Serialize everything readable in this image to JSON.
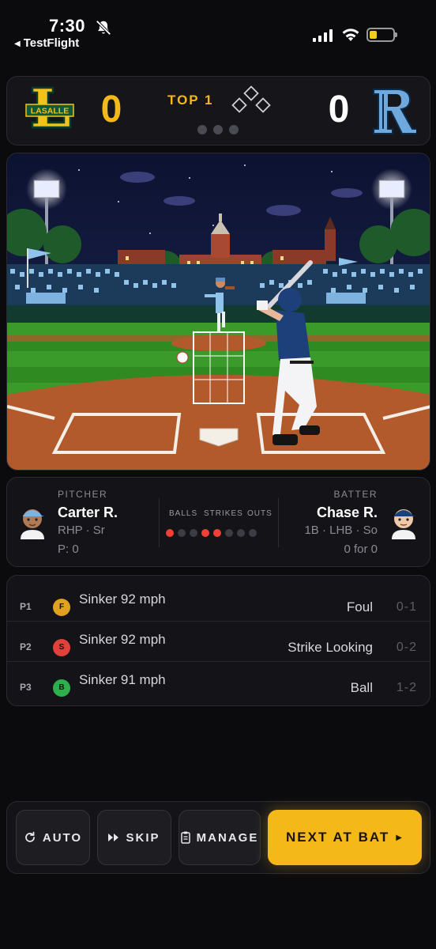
{
  "status_bar": {
    "time": "7:30",
    "back_app": "TestFlight",
    "battery_color": "#f3cb19"
  },
  "scoreboard": {
    "away_team_logo": "L",
    "away_team_logo_text": "LASALLE",
    "away_score": "0",
    "inning": "TOP 1",
    "home_team_logo": "R",
    "home_score": "0",
    "accent_color": "#f5b819"
  },
  "matchup": {
    "pitcher": {
      "role": "PITCHER",
      "name": "Carter R.",
      "info": "RHP · Sr",
      "pitch_count": "P: 0"
    },
    "batter": {
      "role": "BATTER",
      "name": "Chase R.",
      "info": "1B · LHB · So",
      "line": "0 for 0"
    },
    "count": {
      "balls_label": "BALLS",
      "strikes_label": "STRIKES",
      "outs_label": "OUTS",
      "balls": 1,
      "strikes": 2,
      "outs": 0
    }
  },
  "pitch_log": [
    {
      "num": "P1",
      "badge": "F",
      "badge_color": "#e0a21f",
      "pitch": "Sinker 92 mph",
      "result": "Foul",
      "count": "0-1"
    },
    {
      "num": "P2",
      "badge": "S",
      "badge_color": "#e0413a",
      "pitch": "Sinker 92 mph",
      "result": "Strike Looking",
      "count": "0-2"
    },
    {
      "num": "P3",
      "badge": "B",
      "badge_color": "#2fae4e",
      "pitch": "Sinker 91 mph",
      "result": "Ball",
      "count": "1-2"
    }
  ],
  "actions": {
    "auto": "AUTO",
    "skip": "SKIP",
    "manage": "MANAGE",
    "next": "NEXT AT BAT"
  }
}
